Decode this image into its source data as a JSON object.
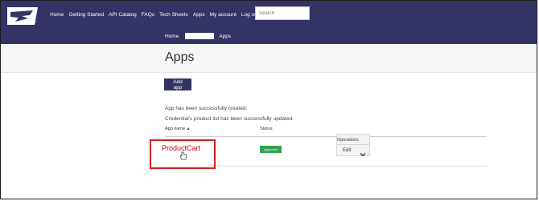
{
  "nav": {
    "items": [
      "Home",
      "Getting Started",
      "API Catalog",
      "FAQs",
      "Tech Sheets",
      "Apps",
      "My account",
      "Log out"
    ],
    "search_placeholder": "Search"
  },
  "breadcrumb": {
    "home": "Home",
    "current": "Apps"
  },
  "page": {
    "title": "Apps"
  },
  "actions": {
    "add_app": "Add app"
  },
  "messages": [
    "App has been successfully created.",
    "Credential's product list has been successfully updated."
  ],
  "table": {
    "headers": {
      "name": "App name",
      "status": "Status",
      "operations": "Operations"
    },
    "rows": [
      {
        "name": "ProductCart",
        "status": "Approved",
        "operation": "Edit"
      }
    ]
  },
  "colors": {
    "brand": "#333366",
    "approved": "#33a150",
    "highlight": "#d31f1f",
    "link": "#c40000"
  },
  "icons": {
    "logo": "eagle-logo-icon",
    "sort": "sort-asc-icon",
    "dropdown": "chevron-down-icon",
    "cursor": "hand-pointer-icon"
  }
}
